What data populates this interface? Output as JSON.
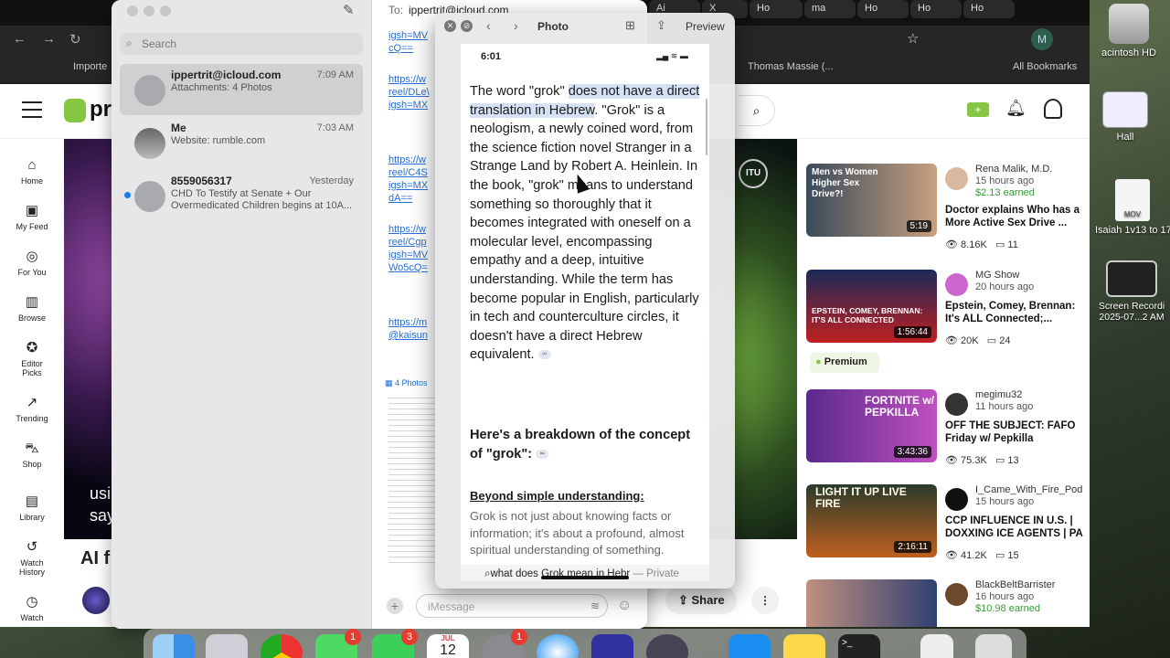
{
  "desktop": {
    "items": [
      {
        "label": "acintosh HD"
      },
      {
        "label": "Hall"
      },
      {
        "label": "Isaiah 1v13 to 17"
      },
      {
        "label": "Screen Recordi\n2025-07...2 AM"
      }
    ],
    "mov_label": "MOV"
  },
  "browser": {
    "tabs": [
      "Ai",
      "X",
      "Ho",
      "ma",
      "Ho",
      "Ho",
      "Ho"
    ],
    "bookmarks": [
      "Importe",
      "Thomas Massie (...",
      "All Bookmarks"
    ],
    "brand": "pr",
    "profile_initial": "M",
    "leftnav": [
      {
        "label": "Home"
      },
      {
        "label": "My Feed"
      },
      {
        "label": "For You"
      },
      {
        "label": "Browse"
      },
      {
        "label": "Editor\nPicks"
      },
      {
        "label": "Trending"
      },
      {
        "label": "Shop"
      },
      {
        "label": "Library"
      },
      {
        "label": "Watch\nHistory"
      },
      {
        "label": "Watch"
      }
    ],
    "video_caption_1": "usi",
    "video_caption_2": "say",
    "below_video_title": "AI f",
    "share_label": "Share",
    "itu_label": "ITU",
    "sidebar": [
      {
        "channel": "Rena Malik, M.D.",
        "time": "15 hours ago",
        "earned": "$2.13 earned",
        "title": "Doctor explains Who has a More Active Sex Drive ...",
        "views": "8.16K",
        "comments": "11",
        "duration": "5:19",
        "thumb_text": "Men vs Women Higher Sex Drive?!"
      },
      {
        "channel": "MG Show",
        "time": "20 hours ago",
        "earned": "",
        "title": "Epstein, Comey, Brennan: It's ALL Connected;...",
        "views": "20K",
        "comments": "24",
        "duration": "1:56:44",
        "thumb_text": "EPSTEIN, COMEY, BRENNAN: IT'S ALL CONNECTED"
      },
      {
        "channel": "megimu32",
        "time": "11 hours ago",
        "earned": "",
        "title": "OFF THE SUBJECT: FAFO Friday w/ Pepkilla",
        "views": "75.3K",
        "comments": "13",
        "duration": "3:43:36",
        "thumb_text": "FORTNITE w/ PEPKILLA"
      },
      {
        "channel": "I_Came_With_Fire_Pod",
        "time": "15 hours ago",
        "earned": "",
        "title": "CCP INFLUENCE IN U.S. | DOXXING ICE AGENTS | PA",
        "views": "41.2K",
        "comments": "15",
        "duration": "2:16:11",
        "thumb_text": "LIGHT IT UP LIVE FIRE"
      },
      {
        "channel": "BlackBeltBarrister",
        "time": "16 hours ago",
        "earned": "$10.98 earned",
        "title": "",
        "views": "",
        "comments": "",
        "duration": "",
        "thumb_text": ""
      }
    ],
    "premium_label": "Premium"
  },
  "messages": {
    "search_placeholder": "Search",
    "to_label": "To:",
    "to_value": "ippertrit@icloud.com",
    "conversations": [
      {
        "name": "ippertrit@icloud.com",
        "time": "7:09 AM",
        "preview": "Attachments: 4 Photos",
        "unread": false
      },
      {
        "name": "Me",
        "time": "7:03 AM",
        "preview": "Website: rumble.com",
        "unread": false
      },
      {
        "name": "8559056317",
        "time": "Yesterday",
        "preview": "CHD To Testify at Senate + Our Overmedicated Children begins at 10A...",
        "unread": true
      }
    ],
    "chat_links": [
      [
        "igsh=MV",
        "cQ=="
      ],
      [
        "https://w",
        "reel/DLe\\",
        "igsh=MX"
      ],
      [
        "https://w",
        "reel/C4S",
        "igsh=MX",
        "dA=="
      ],
      [
        "https://w",
        "reel/Cgp",
        "igsh=MV",
        "Wo5cQ="
      ],
      [
        "https://m",
        "@kaisun"
      ]
    ],
    "photos_label": "4 Photos",
    "imessage_placeholder": "iMessage"
  },
  "preview": {
    "title": "Photo",
    "preview_label": "Preview",
    "status_time": "6:01",
    "para_pre": "The word \"grok\" ",
    "para_hl": "does not have a direct translation in Hebrew",
    "para_post": ". \"Grok\" is a neologism, a newly coined word, from the science fiction novel Stranger in a Strange Land by Robert A. Heinlein. In the book, \"grok\" means to understand something so thoroughly that it becomes integrated with oneself on a molecular level, encompassing empathy and a deep, intuitive understanding. While the term has become popular in English, particularly in tech and counterculture circles, it doesn't have a direct Hebrew equivalent.",
    "heading": "Here's a breakdown of the concept of \"grok\":",
    "subheading": "Beyond simple understanding:",
    "sub_para": "Grok is not just about knowing facts or information; it's about a profound, almost spiritual understanding of something.",
    "search_query": "what does Grok mean in Hebr",
    "private_label": "— Private"
  },
  "dock": {
    "badges": [
      "1",
      "3",
      "1"
    ],
    "calendar_month": "JUL",
    "calendar_day": "12"
  },
  "colors": {
    "rumble_green": "#85c742",
    "link_blue": "#2a6fd6",
    "highlight": "#d5e2f6",
    "badge_red": "#e83b30"
  }
}
